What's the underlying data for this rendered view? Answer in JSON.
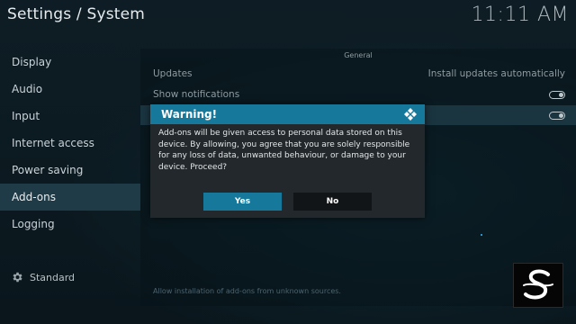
{
  "header": {
    "title": "Settings / System",
    "clock": "11:11 AM"
  },
  "sidebar": {
    "items": [
      {
        "label": "Display"
      },
      {
        "label": "Audio"
      },
      {
        "label": "Input"
      },
      {
        "label": "Internet access"
      },
      {
        "label": "Power saving"
      },
      {
        "label": "Add-ons",
        "active": true
      },
      {
        "label": "Logging"
      }
    ],
    "level_label": "Standard"
  },
  "panel": {
    "section": "General",
    "rows": [
      {
        "label": "Updates",
        "value": "Install updates automatically"
      },
      {
        "label": "Show notifications"
      },
      {
        "label": ""
      }
    ],
    "description": "Allow installation of add-ons from unknown sources."
  },
  "dialog": {
    "title": "Warning!",
    "message": "Add-ons will be given access to personal data stored on this device. By allowing, you agree that you are solely responsible for any loss of data, unwanted behaviour, or damage to your device. Proceed?",
    "yes_label": "Yes",
    "no_label": "No"
  },
  "colors": {
    "accent": "#16789a",
    "background": "#0d1b22",
    "active_item": "#1f3b47"
  },
  "icons": {
    "level": "gear-icon",
    "dialog": "kodi-icon",
    "watermark": "s-logo-icon"
  }
}
